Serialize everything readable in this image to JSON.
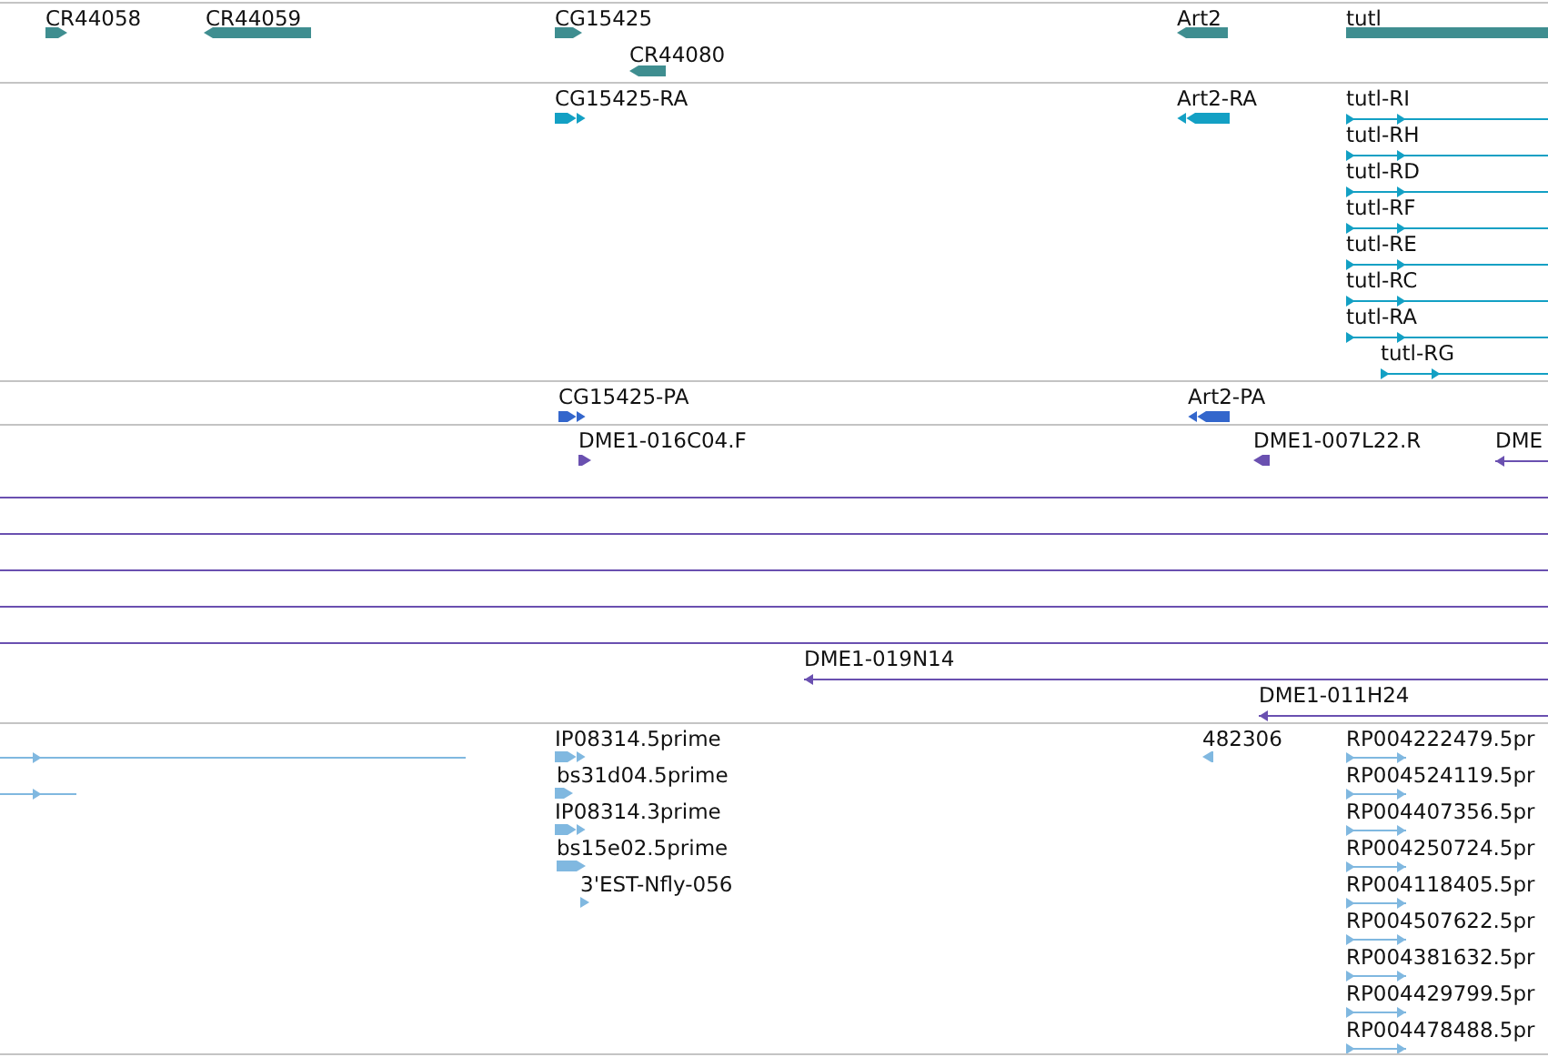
{
  "tracks": [
    {
      "features": [
        {
          "kind": "block",
          "label": "CR44058",
          "reverse": false
        },
        {
          "kind": "block",
          "label": "CR44059",
          "reverse": true
        },
        {
          "kind": "block",
          "label": "CG15425",
          "reverse": false
        },
        {
          "kind": "block",
          "label": "CR44080",
          "reverse": true
        },
        {
          "kind": "block",
          "label": "Art2",
          "reverse": true
        },
        {
          "kind": "block",
          "label": "tutl"
        }
      ]
    },
    {
      "features": [
        {
          "kind": "exons",
          "label": "CG15425-RA",
          "reverse": false
        },
        {
          "kind": "exons",
          "label": "Art2-RA",
          "reverse": true
        },
        {
          "kind": "line",
          "label": "tutl-RI",
          "reverse": false
        },
        {
          "kind": "line",
          "label": "tutl-RH",
          "reverse": false
        },
        {
          "kind": "line",
          "label": "tutl-RD",
          "reverse": false
        },
        {
          "kind": "line",
          "label": "tutl-RF",
          "reverse": false
        },
        {
          "kind": "line",
          "label": "tutl-RE",
          "reverse": false
        },
        {
          "kind": "line",
          "label": "tutl-RC",
          "reverse": false
        },
        {
          "kind": "line",
          "label": "tutl-RA",
          "reverse": false
        },
        {
          "kind": "line",
          "label": "tutl-RG",
          "reverse": false
        }
      ]
    },
    {
      "features": [
        {
          "kind": "exons",
          "label": "CG15425-PA",
          "reverse": false
        },
        {
          "kind": "exons",
          "label": "Art2-PA",
          "reverse": true
        }
      ]
    },
    {
      "features": [
        {
          "kind": "block",
          "label": "DME1-016C04.F",
          "reverse": false
        },
        {
          "kind": "block",
          "label": "DME1-007L22.R",
          "reverse": true
        },
        {
          "kind": "line",
          "label": "DME",
          "reverse": true
        },
        {
          "kind": "line"
        },
        {
          "kind": "line"
        },
        {
          "kind": "line"
        },
        {
          "kind": "line"
        },
        {
          "kind": "line"
        },
        {
          "kind": "line",
          "label": "DME1-019N14",
          "reverse": true
        },
        {
          "kind": "line",
          "label": "DME1-011H24",
          "reverse": true
        }
      ]
    },
    {
      "features": [
        {
          "kind": "line",
          "reverse": false
        },
        {
          "kind": "line",
          "reverse": false
        },
        {
          "kind": "exons",
          "label": "IP08314.5prime",
          "reverse": false
        },
        {
          "kind": "block",
          "label": "bs31d04.5prime",
          "reverse": false
        },
        {
          "kind": "exons",
          "label": "IP08314.3prime",
          "reverse": false
        },
        {
          "kind": "block",
          "label": "bs15e02.5prime",
          "reverse": false
        },
        {
          "kind": "block",
          "label": "3'EST-Nfly-056",
          "reverse": false
        },
        {
          "kind": "block",
          "label": "482306",
          "reverse": true
        },
        {
          "kind": "line",
          "label": "RP004222479.5pr",
          "reverse": false
        },
        {
          "kind": "line",
          "label": "RP004524119.5pr",
          "reverse": false
        },
        {
          "kind": "line",
          "label": "RP004407356.5pr",
          "reverse": false
        },
        {
          "kind": "line",
          "label": "RP004250724.5pr",
          "reverse": false
        },
        {
          "kind": "line",
          "label": "RP004118405.5pr",
          "reverse": false
        },
        {
          "kind": "line",
          "label": "RP004507622.5pr",
          "reverse": false
        },
        {
          "kind": "line",
          "label": "RP004381632.5pr",
          "reverse": false
        },
        {
          "kind": "line",
          "label": "RP004429799.5pr",
          "reverse": false
        },
        {
          "kind": "line",
          "label": "RP004478488.5pr",
          "reverse": false
        }
      ]
    }
  ]
}
